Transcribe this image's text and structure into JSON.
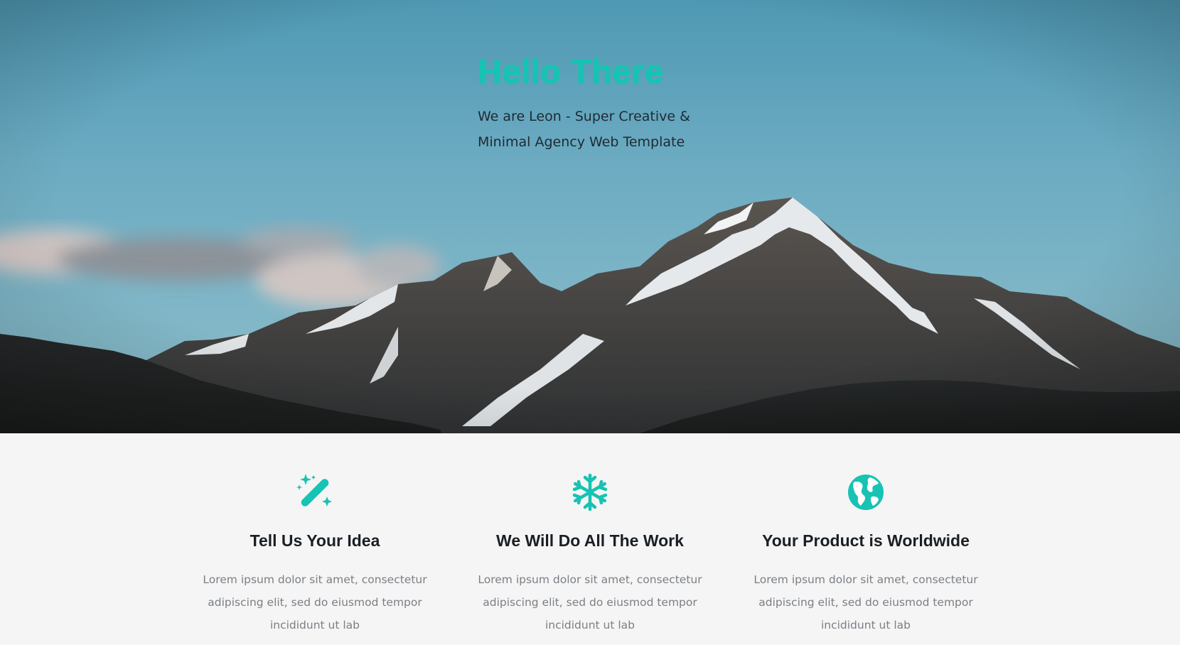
{
  "colors": {
    "accent": "#17c3b2",
    "heading_dark": "#1a1f24",
    "body_text": "#7a7f85",
    "features_bg": "#f5f5f5"
  },
  "hero": {
    "title": "Hello There",
    "subtitle_line1": "We are Leon - Super Creative &",
    "subtitle_line2": "Minimal Agency Web Template"
  },
  "features": [
    {
      "icon": "magic-wand-icon",
      "title": "Tell Us Your Idea",
      "text": "Lorem ipsum dolor sit amet, consectetur adipiscing elit, sed do eiusmod tempor incididunt ut lab"
    },
    {
      "icon": "snowflake-icon",
      "title": "We Will Do All The Work",
      "text": "Lorem ipsum dolor sit amet, consectetur adipiscing elit, sed do eiusmod tempor incididunt ut lab"
    },
    {
      "icon": "globe-icon",
      "title": "Your Product is Worldwide",
      "text": "Lorem ipsum dolor sit amet, consectetur adipiscing elit, sed do eiusmod tempor incididunt ut lab"
    }
  ]
}
